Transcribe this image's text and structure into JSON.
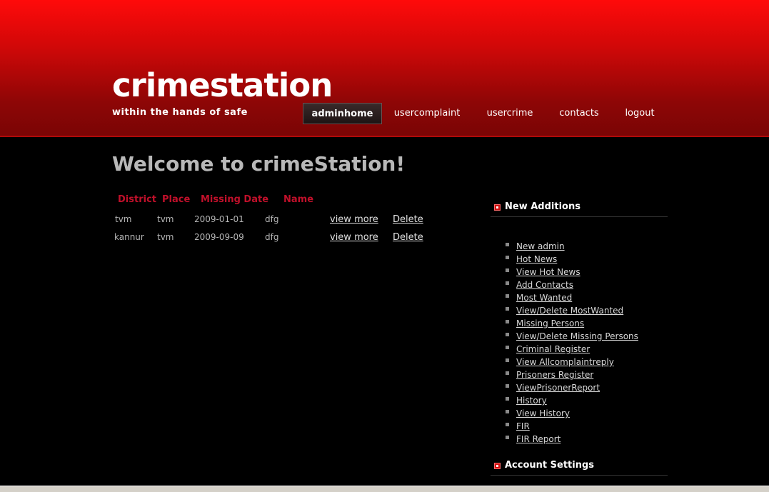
{
  "brand": {
    "logo": "crimestation",
    "tagline": "within the hands of safe"
  },
  "nav": {
    "items": [
      {
        "label": "adminhome",
        "active": true
      },
      {
        "label": "usercomplaint",
        "active": false
      },
      {
        "label": "usercrime",
        "active": false
      },
      {
        "label": "contacts",
        "active": false
      },
      {
        "label": "logout",
        "active": false
      }
    ]
  },
  "main": {
    "title": "Welcome to crimeStation!",
    "table": {
      "headers": [
        "District",
        "Place",
        "Missing Date",
        "Name"
      ],
      "rows": [
        {
          "district": "tvm",
          "place": "tvm",
          "date": "2009-01-01",
          "name": "dfg",
          "view": "view more",
          "delete": "Delete"
        },
        {
          "district": "kannur",
          "place": "tvm",
          "date": "2009-09-09",
          "name": "dfg",
          "view": "view more",
          "delete": "Delete"
        }
      ]
    }
  },
  "sidebar": {
    "new_additions_title": "New Additions",
    "links": [
      "New admin",
      "Hot News",
      "View Hot News",
      "Add Contacts",
      "Most Wanted",
      "View/Delete MostWanted",
      "Missing Persons",
      "View/Delete Missing Persons",
      "Criminal Register",
      "View Allcomplaintreply",
      "Prisoners Register",
      "ViewPrisonerReport",
      "History",
      "View History",
      "FIR",
      "FIR Report"
    ],
    "account_title": "Account Settings"
  },
  "colors": {
    "header_red": "#ff0a0a",
    "header_dark": "#7a0505",
    "table_header": "#c0102a",
    "background": "#000000"
  }
}
